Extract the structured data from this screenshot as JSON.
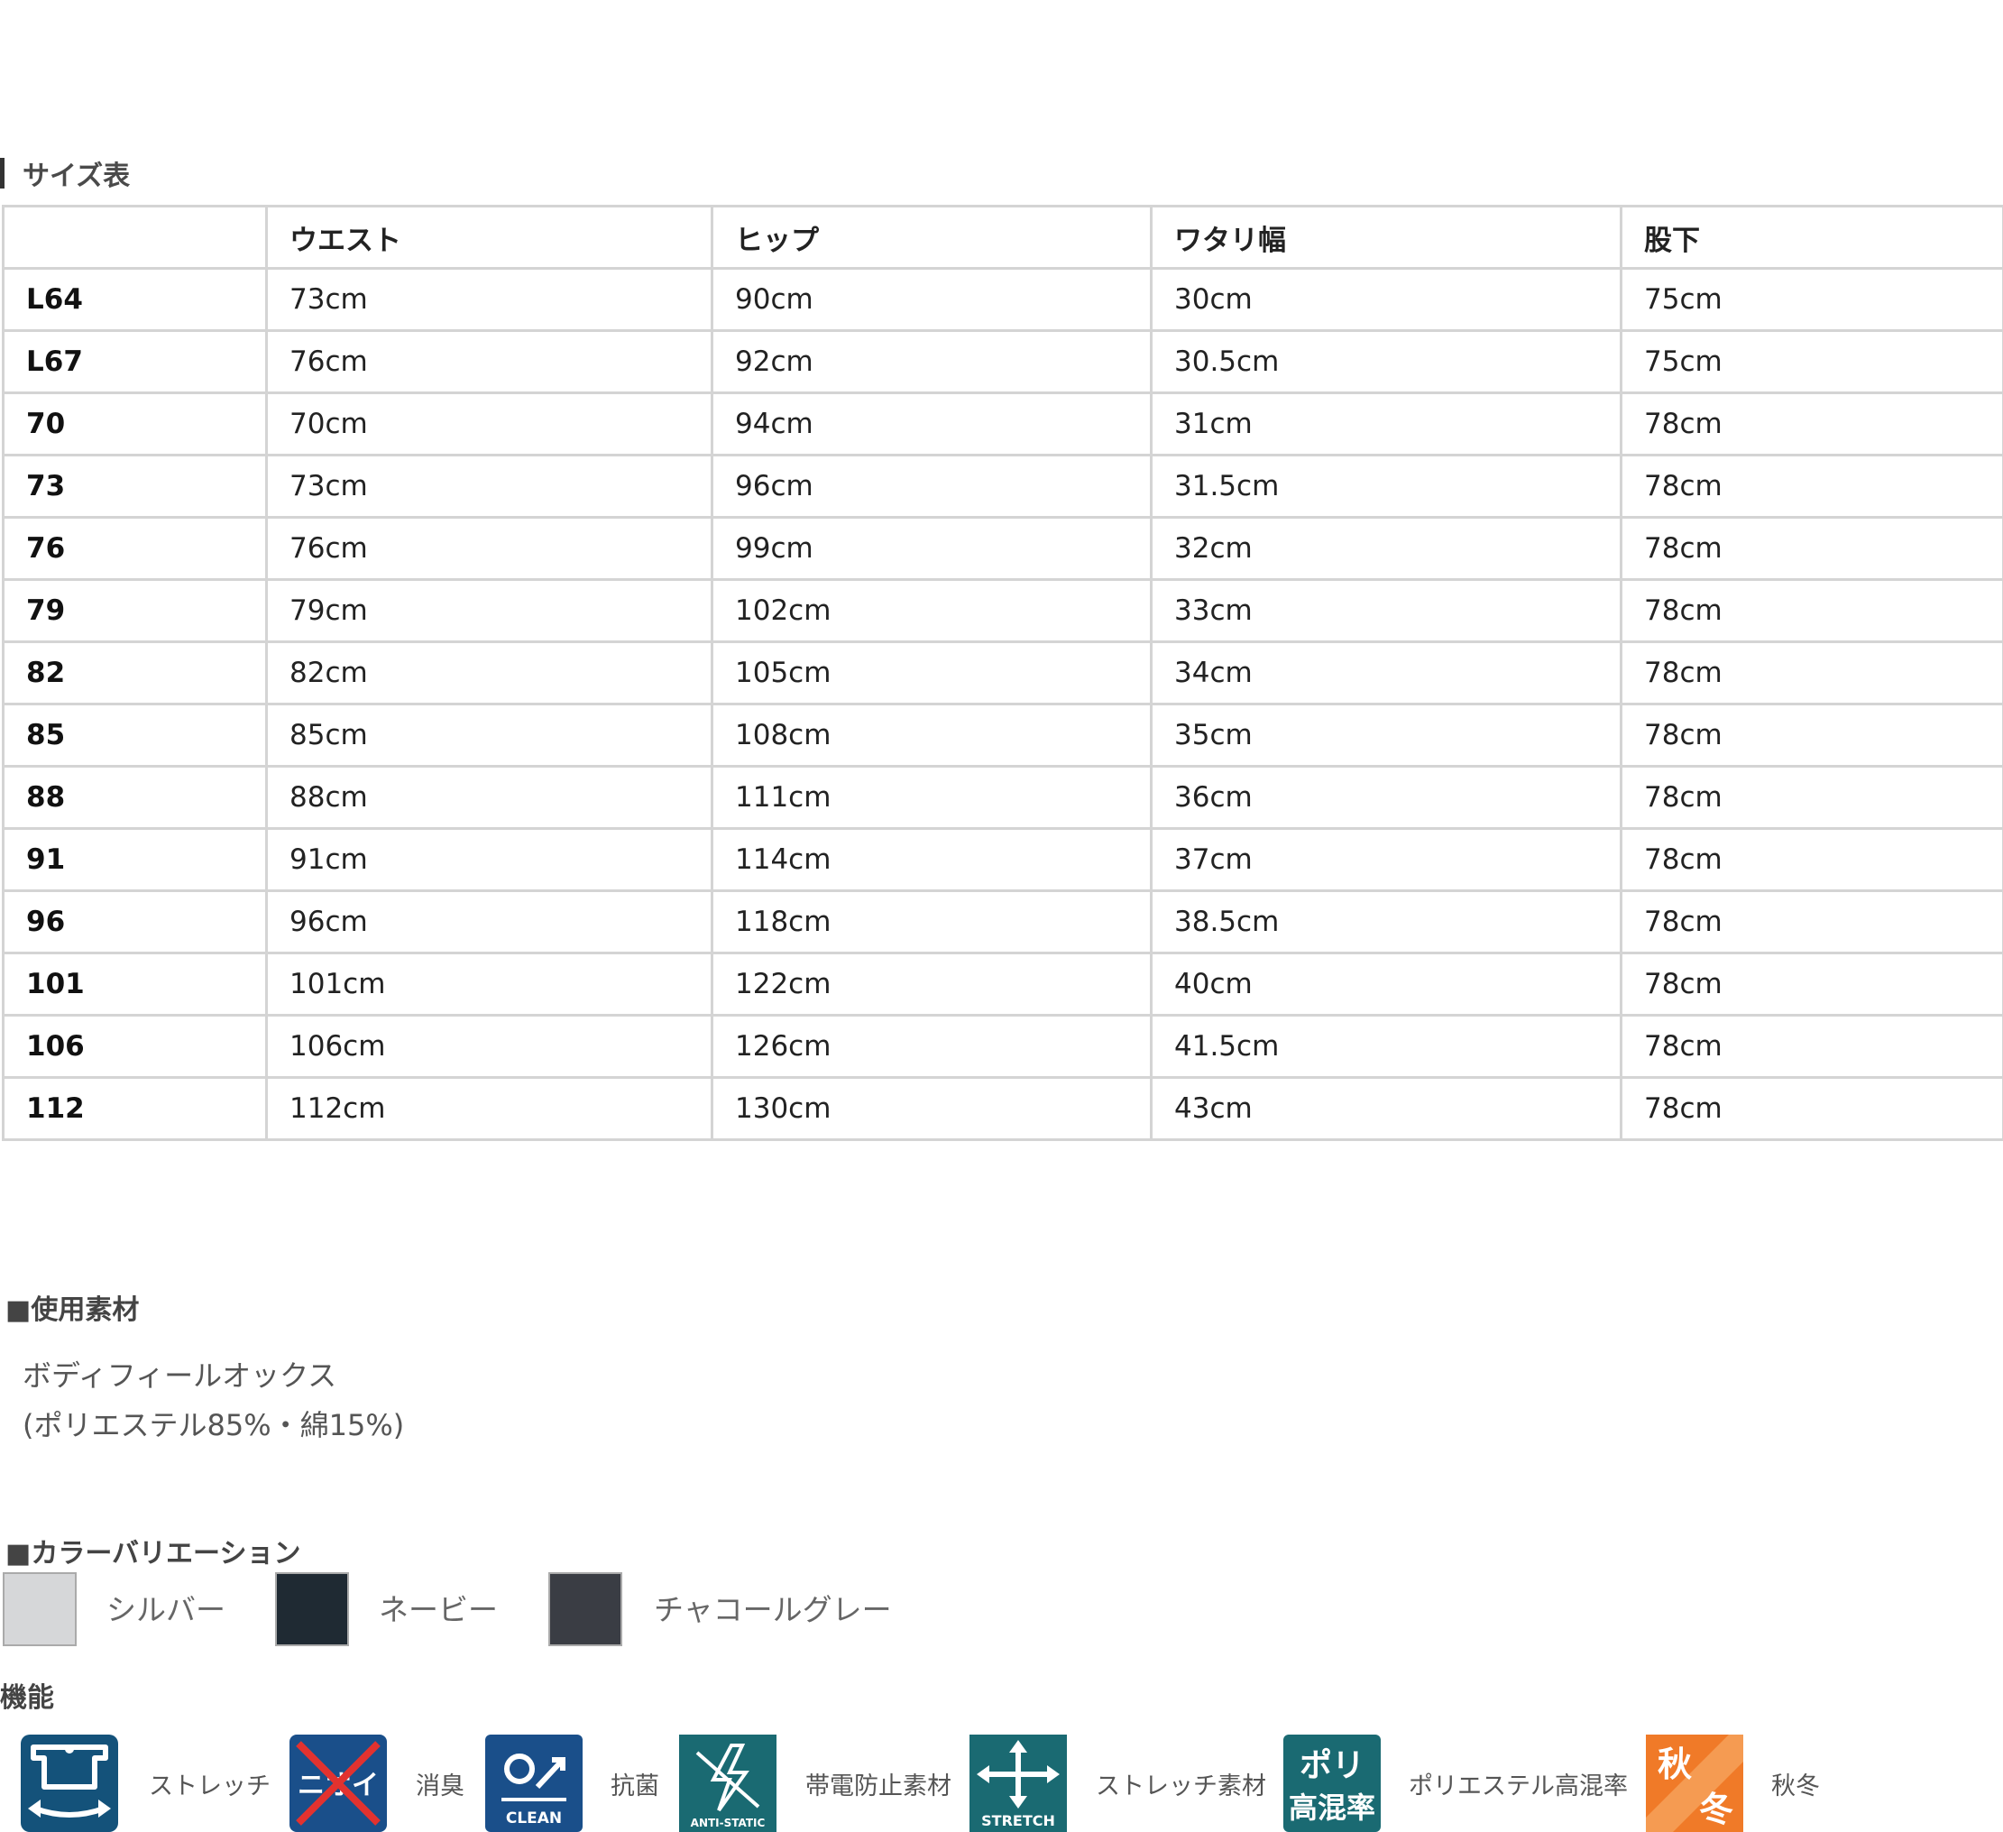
{
  "size_table": {
    "title": "サイズ表",
    "headers": [
      "",
      "ウエスト",
      "ヒップ",
      "ワタリ幅",
      "股下"
    ],
    "rows": [
      [
        "L64",
        "73cm",
        "90cm",
        "30cm",
        "75cm"
      ],
      [
        "L67",
        "76cm",
        "92cm",
        "30.5cm",
        "75cm"
      ],
      [
        "70",
        "70cm",
        "94cm",
        "31cm",
        "78cm"
      ],
      [
        "73",
        "73cm",
        "96cm",
        "31.5cm",
        "78cm"
      ],
      [
        "76",
        "76cm",
        "99cm",
        "32cm",
        "78cm"
      ],
      [
        "79",
        "79cm",
        "102cm",
        "33cm",
        "78cm"
      ],
      [
        "82",
        "82cm",
        "105cm",
        "34cm",
        "78cm"
      ],
      [
        "85",
        "85cm",
        "108cm",
        "35cm",
        "78cm"
      ],
      [
        "88",
        "88cm",
        "111cm",
        "36cm",
        "78cm"
      ],
      [
        "91",
        "91cm",
        "114cm",
        "37cm",
        "78cm"
      ],
      [
        "96",
        "96cm",
        "118cm",
        "38.5cm",
        "78cm"
      ],
      [
        "101",
        "101cm",
        "122cm",
        "40cm",
        "78cm"
      ],
      [
        "106",
        "106cm",
        "126cm",
        "41.5cm",
        "78cm"
      ],
      [
        "112",
        "112cm",
        "130cm",
        "43cm",
        "78cm"
      ]
    ]
  },
  "material": {
    "title": "■使用素材",
    "name": "ボディフィールオックス",
    "composition": "(ポリエステル85%・綿15%)"
  },
  "colors": {
    "title": "■カラーバリエーション",
    "items": [
      {
        "label": "シルバー",
        "swatch": "#d6d7d9"
      },
      {
        "label": "ネービー",
        "swatch": "#1f2a33"
      },
      {
        "label": "チャコールグレー",
        "swatch": "#3a3d44"
      }
    ]
  },
  "features": {
    "title": "機能",
    "items": [
      {
        "label": "ストレッチ",
        "icon": "stretch-shirt-icon",
        "color": "#14527a"
      },
      {
        "label": "消臭",
        "icon": "deodorant-icon",
        "color": "#1a4f8a",
        "icon_text": "ニオイ"
      },
      {
        "label": "抗菌",
        "icon": "antibacterial-clean-icon",
        "color": "#1a4f8a",
        "icon_text": "CLEAN"
      },
      {
        "label": "帯電防止素材",
        "icon": "anti-static-icon",
        "color": "#1a6a72",
        "icon_text": "ANTI-STATIC"
      },
      {
        "label": "ストレッチ素材",
        "icon": "stretch-material-icon",
        "color": "#1a6a72",
        "icon_text": "STRETCH"
      },
      {
        "label": "ポリエステル高混率",
        "icon": "polyester-high-blend-icon",
        "color": "#1a6a72",
        "icon_text_top": "ポリ",
        "icon_text_bottom": "高混率"
      },
      {
        "label": "秋冬",
        "icon": "autumn-winter-icon",
        "color": "#f07a28",
        "icon_text_top": "秋",
        "icon_text_bottom": "冬"
      }
    ]
  }
}
